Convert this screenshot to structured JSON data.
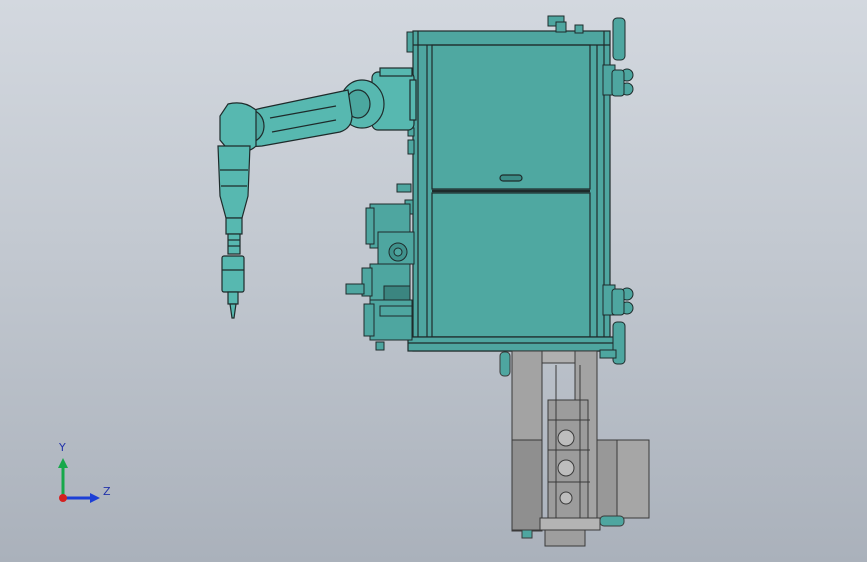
{
  "viewport": {
    "background_top": "#d3d8df",
    "background_bottom": "#aab1bb"
  },
  "model": {
    "cabinet_color": "#4ea6a0",
    "frame_color": "#2e6e6a",
    "robot_color": "#57b8b0",
    "mechanism_color": "#9a9a9a",
    "edge_color": "#1e2b2b"
  },
  "triad": {
    "y_label": "Y",
    "z_label": "Z",
    "y_color": "#17a84a",
    "z_color": "#1c3fd6",
    "origin_color": "#d42020"
  }
}
